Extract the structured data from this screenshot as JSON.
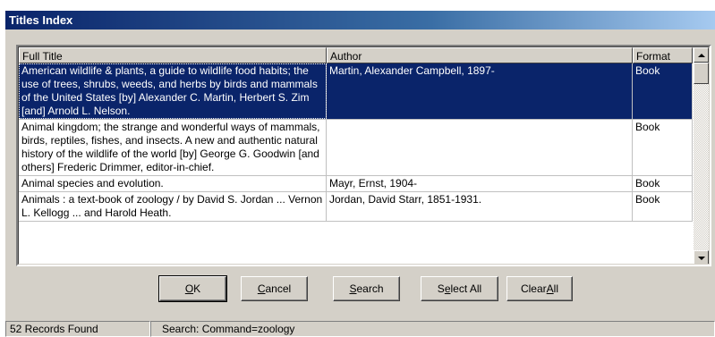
{
  "window": {
    "title": "Titles Index"
  },
  "table": {
    "columns": [
      "Full Title",
      "Author",
      "Format"
    ],
    "rows": [
      {
        "title": "American wildlife & plants, a guide to wildlife food habits; the use of trees, shrubs, weeds, and herbs by birds and mammals of the United States [by] Alexander C. Martin, Herbert S. Zim [and] Arnold L. Nelson.",
        "author": "Martin, Alexander Campbell, 1897-",
        "format": "Book",
        "selected": true
      },
      {
        "title": "Animal kingdom; the strange and wonderful ways of mammals, birds, reptiles, fishes, and insects. A new and authentic natural history of the wildlife of the world [by] George G. Goodwin [and others] Frederic Drimmer, editor-in-chief.",
        "author": "",
        "format": "Book",
        "selected": false
      },
      {
        "title": "Animal species and evolution.",
        "author": "Mayr, Ernst, 1904-",
        "format": "Book",
        "selected": false
      },
      {
        "title": "Animals : a text-book of zoology / by David S. Jordan ... Vernon L. Kellogg ... and Harold Heath.",
        "author": "Jordan, David Starr, 1851-1931.",
        "format": "Book",
        "selected": false
      }
    ]
  },
  "buttons": {
    "ok": {
      "pre": "",
      "key": "O",
      "post": "K"
    },
    "cancel": {
      "pre": "",
      "key": "C",
      "post": "ancel"
    },
    "search": {
      "pre": "",
      "key": "S",
      "post": "earch"
    },
    "select_all": {
      "pre": "S",
      "key": "e",
      "post": "lect All"
    },
    "clear_all": {
      "pre": "Clear ",
      "key": "A",
      "post": "ll"
    }
  },
  "status": {
    "records": "52 Records Found",
    "search": "Search: Command=zoology"
  }
}
